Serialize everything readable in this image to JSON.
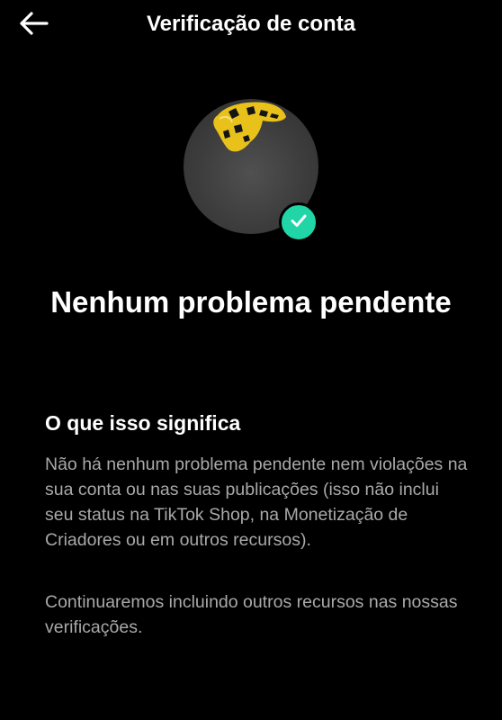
{
  "header": {
    "title": "Verificação de conta",
    "back_icon": "arrow-left-icon"
  },
  "profile": {
    "badge_icon": "checkmark-icon",
    "badge_color": "#20d5a6"
  },
  "status": {
    "title": "Nenhum problema pendente"
  },
  "info": {
    "heading": "O que isso significa",
    "paragraph_1": "Não há nenhum problema pendente nem violações na sua conta ou nas suas publicações (isso não inclui seu status na TikTok Shop, na Monetização de Criadores ou em outros recursos).",
    "paragraph_2": "Continuaremos incluindo outros recursos nas nossas verificações."
  },
  "colors": {
    "background": "#000000",
    "text_primary": "#ffffff",
    "text_secondary": "#a9a9a9"
  }
}
